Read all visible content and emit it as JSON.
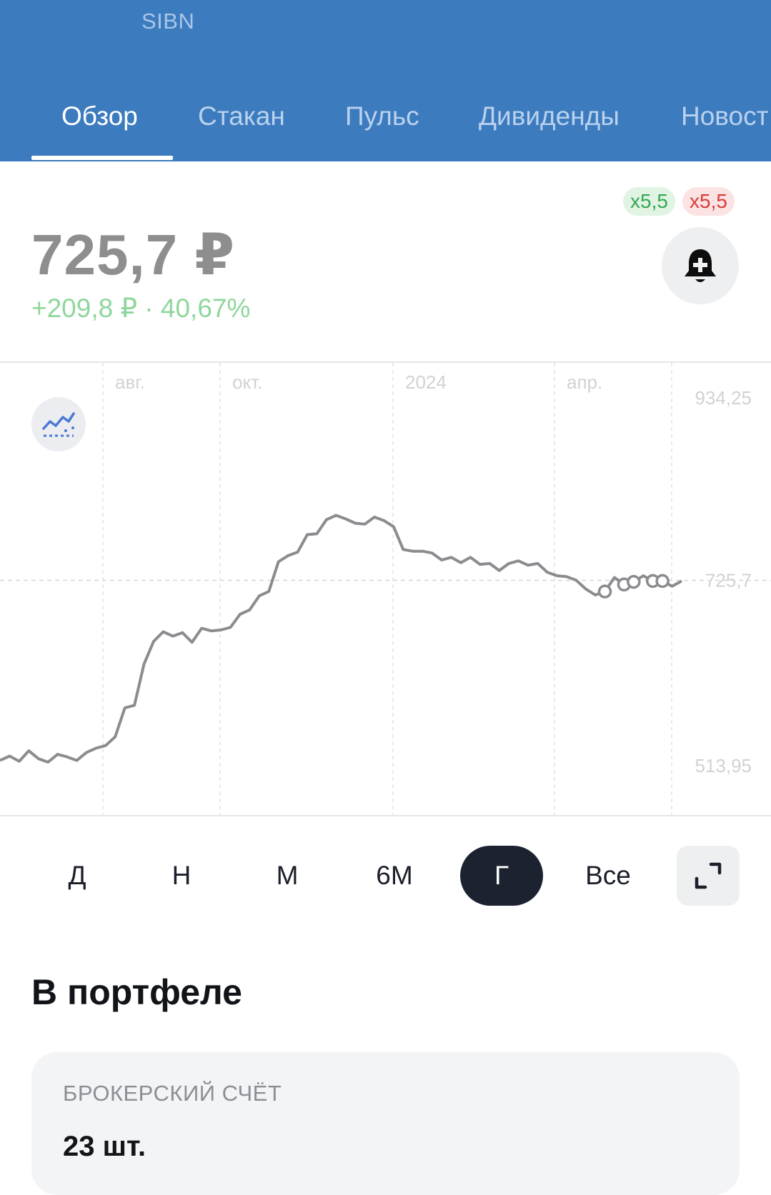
{
  "header": {
    "ticker": "SIBN",
    "tabs": [
      {
        "label": "Обзор",
        "active": true
      },
      {
        "label": "Стакан"
      },
      {
        "label": "Пульс"
      },
      {
        "label": "Дивиденды"
      },
      {
        "label": "Новост"
      }
    ]
  },
  "quote": {
    "price": "725,7 ₽",
    "change": "+209,8 ₽ · 40,67%",
    "leverage_long": "x5,5",
    "leverage_short": "x5,5"
  },
  "icons": {
    "alert": "bell-plus-icon",
    "indicators": "indicators-icon",
    "expand": "expand-icon"
  },
  "colors": {
    "header_bg": "#3d7bbf",
    "price": "#8e8e8e",
    "change_positive": "#8fd69b",
    "line": "#8a8c8f",
    "active_period_bg": "#1c2230"
  },
  "chart_data": {
    "type": "line",
    "x_tick_labels": [
      "авг.",
      "окт.",
      "2024",
      "апр."
    ],
    "y_tick_labels": [
      "934,25",
      "725,7",
      "513,95"
    ],
    "ylim": [
      513.95,
      934.25
    ],
    "current_value": 725.7,
    "grid": "dashed",
    "series": [
      {
        "values": [
          520,
          525,
          519,
          531,
          522,
          518,
          527,
          524,
          520,
          529,
          534,
          537,
          547,
          580,
          583,
          630,
          656,
          667,
          662,
          666,
          655,
          671,
          668,
          669,
          672,
          687,
          692,
          708,
          713,
          747,
          754,
          758,
          778,
          779,
          795,
          800,
          796,
          791,
          790,
          798,
          794,
          787,
          761,
          759,
          759,
          757,
          749,
          752,
          746,
          752,
          744,
          745,
          737,
          745,
          748,
          743,
          745,
          735,
          731,
          730,
          726,
          716,
          709,
          713,
          729,
          721,
          724,
          731,
          725,
          725,
          719,
          725
        ]
      }
    ]
  },
  "periods": [
    {
      "label": "Д"
    },
    {
      "label": "Н"
    },
    {
      "label": "М"
    },
    {
      "label": "6М"
    },
    {
      "label": "Г",
      "active": true
    },
    {
      "label": "Все"
    }
  ],
  "portfolio": {
    "title": "В портфеле",
    "account_label": "БРОКЕРСКИЙ СЧЁТ",
    "quantity": "23 шт."
  }
}
